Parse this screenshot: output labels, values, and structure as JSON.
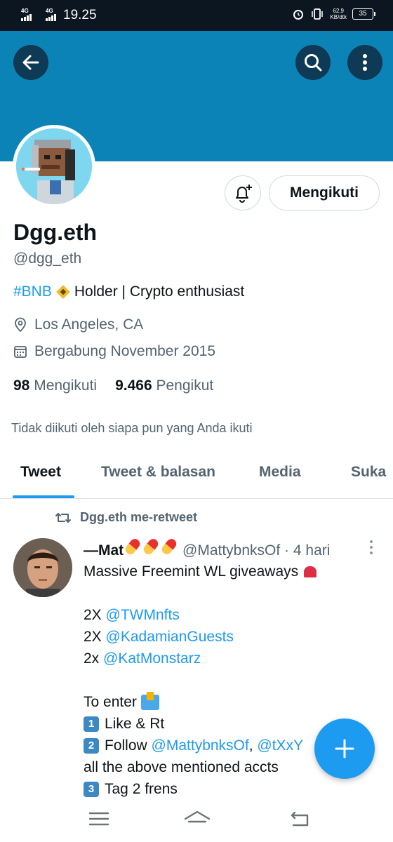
{
  "status_bar": {
    "network1": "4G",
    "network2": "4G",
    "time": "19.25",
    "speed_value": "62,9",
    "speed_unit": "KB/dtk",
    "battery": "35"
  },
  "header": {
    "back_icon": "arrow-left-icon",
    "search_icon": "search-icon",
    "more_icon": "more-vertical-icon",
    "banner_color": "#0b83b7"
  },
  "profile": {
    "display_name": "Dgg.eth",
    "handle": "@dgg_eth",
    "bio_hashtag": "#BNB",
    "bio_text": "Holder | Crypto enthusiast",
    "location": "Los Angeles, CA",
    "joined": "Bergabung November 2015",
    "following_count": "98",
    "following_label": "Mengikuti",
    "followers_count": "9.466",
    "followers_label": "Pengikut",
    "no_mutuals": "Tidak diikuti oleh siapa pun yang Anda ikuti",
    "follow_button": "Mengikuti",
    "notify_icon": "bell-plus-icon"
  },
  "tabs": [
    {
      "label": "Tweet",
      "active": true
    },
    {
      "label": "Tweet & balasan",
      "active": false
    },
    {
      "label": "Media",
      "active": false
    },
    {
      "label": "Suka",
      "active": false
    }
  ],
  "tweet": {
    "retweet_label": "Dgg.eth me-retweet",
    "author_name": "—Mat",
    "author_handle": "@MattybnksOf",
    "time": "· 4 hari",
    "lines": {
      "l1": "Massive Freemint WL giveaways",
      "l2_prefix": "2X",
      "l2_mention": "@TWMnfts",
      "l3_prefix": "2X",
      "l3_mention": "@KadamianGuests",
      "l4_prefix": "2x",
      "l4_mention": "@KatMonstarz",
      "l5": "To enter",
      "l6_key": "1",
      "l6": "Like & Rt",
      "l7_key": "2",
      "l7_text": "Follow",
      "l7_mention1": "@MattybnksOf",
      "l7_sep": ",",
      "l7_mention2": "@tXxY",
      "l8": "all the above mentioned accts",
      "l9_key": "3",
      "l9": "Tag 2 frens"
    }
  },
  "fab": {
    "icon": "plus-icon",
    "color": "#1d9bf0"
  },
  "navbar": {
    "menu_icon": "menu-icon",
    "home_icon": "home-icon",
    "back_icon": "back-icon"
  },
  "colors": {
    "accent": "#1d9bf0",
    "text": "#0f1419",
    "secondary": "#536471"
  }
}
